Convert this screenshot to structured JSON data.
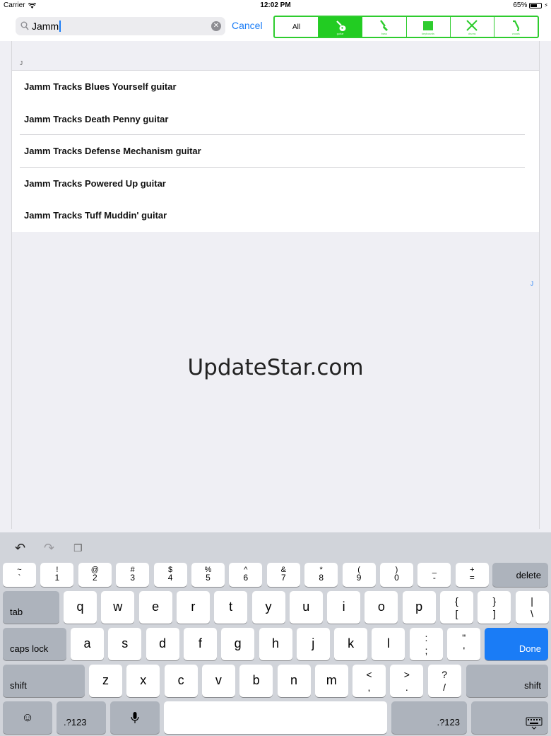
{
  "status_bar": {
    "carrier": "Carrier",
    "time": "12:02 PM",
    "battery": "65%",
    "battery_level": 0.65
  },
  "search": {
    "value": "Jamm",
    "cancel_label": "Cancel"
  },
  "filters": [
    {
      "label": "All",
      "icon": "all-text",
      "active": false
    },
    {
      "label": "guitar",
      "icon": "guitar-icon",
      "active": true
    },
    {
      "label": "bass",
      "icon": "bass-icon",
      "active": false
    },
    {
      "label": "keyboards",
      "icon": "keyboard-icon",
      "active": false
    },
    {
      "label": "drums",
      "icon": "drums-icon",
      "active": false
    },
    {
      "label": "vocals",
      "icon": "microphone-icon",
      "active": false
    }
  ],
  "list": {
    "section": "J",
    "index_letter": "J",
    "items": [
      "Jamm Tracks  Blues Yourself guitar",
      "Jamm Tracks  Death Penny guitar",
      "Jamm Tracks  Defense Mechanism guitar",
      "Jamm Tracks  Powered Up guitar",
      "Jamm Tracks  Tuff Muddin' guitar"
    ]
  },
  "watermark": "UpdateStar.com",
  "keyboard": {
    "number_row": [
      {
        "top": "~",
        "bottom": "`"
      },
      {
        "top": "!",
        "bottom": "1"
      },
      {
        "top": "@",
        "bottom": "2"
      },
      {
        "top": "#",
        "bottom": "3"
      },
      {
        "top": "$",
        "bottom": "4"
      },
      {
        "top": "%",
        "bottom": "5"
      },
      {
        "top": "^",
        "bottom": "6"
      },
      {
        "top": "&",
        "bottom": "7"
      },
      {
        "top": "*",
        "bottom": "8"
      },
      {
        "top": "(",
        "bottom": "9"
      },
      {
        "top": ")",
        "bottom": "0"
      },
      {
        "top": "_",
        "bottom": "-"
      },
      {
        "top": "+",
        "bottom": "="
      }
    ],
    "delete": "delete",
    "tab": "tab",
    "row_q": [
      "q",
      "w",
      "e",
      "r",
      "t",
      "y",
      "u",
      "i",
      "o",
      "p"
    ],
    "row_q_symbols": [
      {
        "top": "{",
        "bottom": "["
      },
      {
        "top": "}",
        "bottom": "]"
      },
      {
        "top": "|",
        "bottom": "\\"
      }
    ],
    "caps_lock": "caps lock",
    "row_a": [
      "a",
      "s",
      "d",
      "f",
      "g",
      "h",
      "j",
      "k",
      "l"
    ],
    "row_a_symbols": [
      {
        "top": ":",
        "bottom": ";"
      },
      {
        "top": "\"",
        "bottom": "'"
      }
    ],
    "done": "Done",
    "shift": "shift",
    "row_z": [
      "z",
      "x",
      "c",
      "v",
      "b",
      "n",
      "m"
    ],
    "row_z_symbols": [
      {
        "top": "<",
        "bottom": ","
      },
      {
        "top": ">",
        "bottom": "."
      },
      {
        "top": "?",
        "bottom": "/"
      }
    ],
    "numbers_label": ".?123"
  }
}
